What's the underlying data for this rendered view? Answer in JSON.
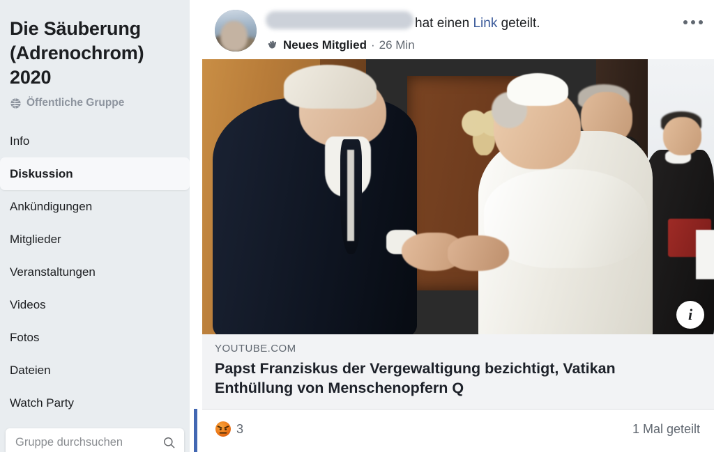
{
  "sidebar": {
    "group_title": "Die Säuberung (Adrenochrom) 2020",
    "privacy_label": "Öffentliche Gruppe",
    "privacy_icon": "globe-icon",
    "nav_items": [
      {
        "label": "Info",
        "active": false
      },
      {
        "label": "Diskussion",
        "active": true
      },
      {
        "label": "Ankündigungen",
        "active": false
      },
      {
        "label": "Mitglieder",
        "active": false
      },
      {
        "label": "Veranstaltungen",
        "active": false
      },
      {
        "label": "Videos",
        "active": false
      },
      {
        "label": "Fotos",
        "active": false
      },
      {
        "label": "Dateien",
        "active": false
      },
      {
        "label": "Watch Party",
        "active": false
      }
    ],
    "search": {
      "placeholder": "Gruppe durchsuchen",
      "icon": "search-icon"
    }
  },
  "post": {
    "author_name": "",
    "author_redacted": true,
    "action_text_before_link": "hat einen",
    "action_link_text": "Link",
    "action_text_after_link": "geteilt.",
    "badge_icon": "waving-hand-icon",
    "badge_label": "Neues Mitglied",
    "meta_separator": "·",
    "timestamp": "26 Min",
    "menu_icon": "more-options-icon",
    "photo": {
      "info_button_label": "i",
      "alt_description": "Handschlag zwischen Mann im dunklen Anzug und Papst in weißem Gewand"
    },
    "link_card": {
      "domain": "YOUTUBE.COM",
      "title": "Papst Franziskus der Vergewaltigung bezichtigt, Vatikan Enthüllung von Menschenopfern Q"
    },
    "reactions": {
      "emoji": "angry-reaction-icon",
      "count": "3",
      "shares_label": "1 Mal geteilt"
    }
  },
  "colors": {
    "sidebar_bg": "#e9edf0",
    "active_item_bg": "#f7f8fa",
    "link_blue": "#385898",
    "accent_blue": "#4267b2",
    "card_bg": "#f2f3f5",
    "muted_text": "#606770",
    "primary_text": "#1c1e21",
    "angry_orange": "#e8850c"
  }
}
